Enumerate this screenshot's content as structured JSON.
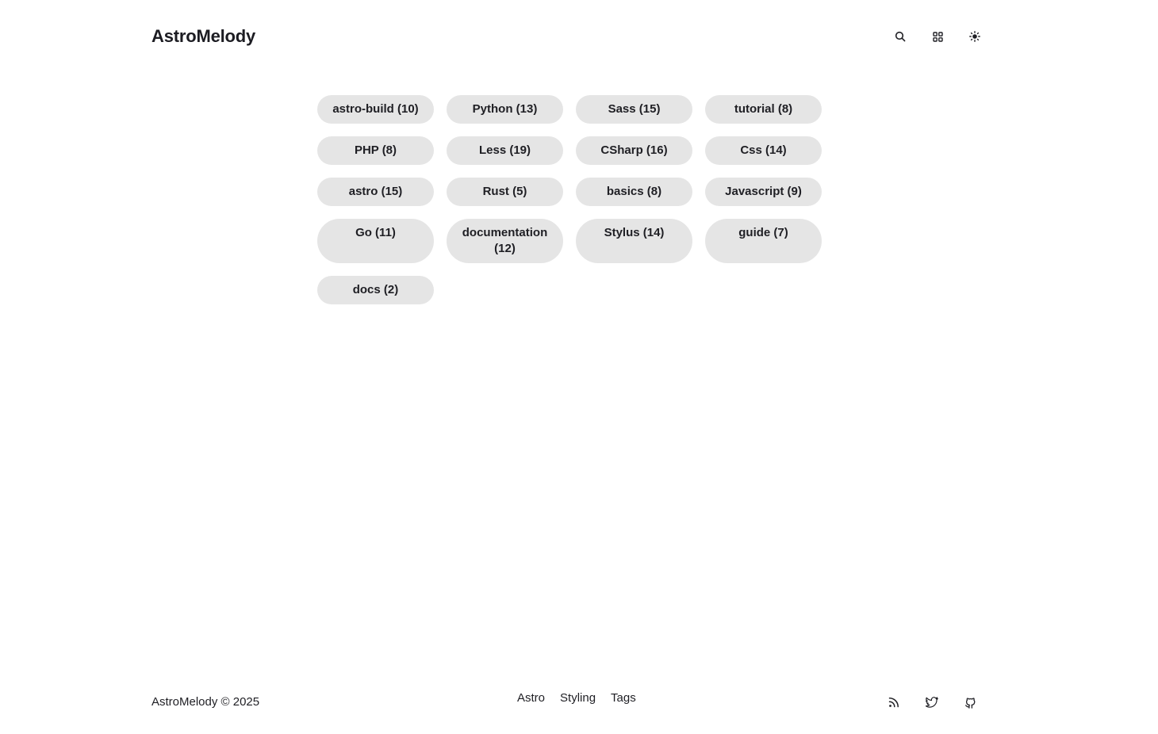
{
  "header": {
    "site_title": "AstroMelody",
    "icons": [
      "search-icon",
      "grid-icon",
      "sun-icon"
    ]
  },
  "tags": [
    {
      "label": "astro-build (10)"
    },
    {
      "label": "Python (13)"
    },
    {
      "label": "Sass (15)"
    },
    {
      "label": "tutorial (8)"
    },
    {
      "label": "PHP (8)"
    },
    {
      "label": "Less (19)"
    },
    {
      "label": "CSharp (16)"
    },
    {
      "label": "Css (14)"
    },
    {
      "label": "astro (15)"
    },
    {
      "label": "Rust (5)"
    },
    {
      "label": "basics (8)"
    },
    {
      "label": "Javascript (9)"
    },
    {
      "label": "Go (11)"
    },
    {
      "label": "documentation (12)"
    },
    {
      "label": "Stylus (14)"
    },
    {
      "label": "guide (7)"
    },
    {
      "label": "docs (2)"
    }
  ],
  "footer": {
    "copyright": "AstroMelody © 2025",
    "nav": [
      "Astro",
      "Styling",
      "Tags"
    ],
    "social_icons": [
      "rss-icon",
      "twitter-icon",
      "github-icon"
    ]
  },
  "colors": {
    "tag_background": "#e5e5e5",
    "text": "#1f1f24",
    "page_background": "#ffffff"
  }
}
